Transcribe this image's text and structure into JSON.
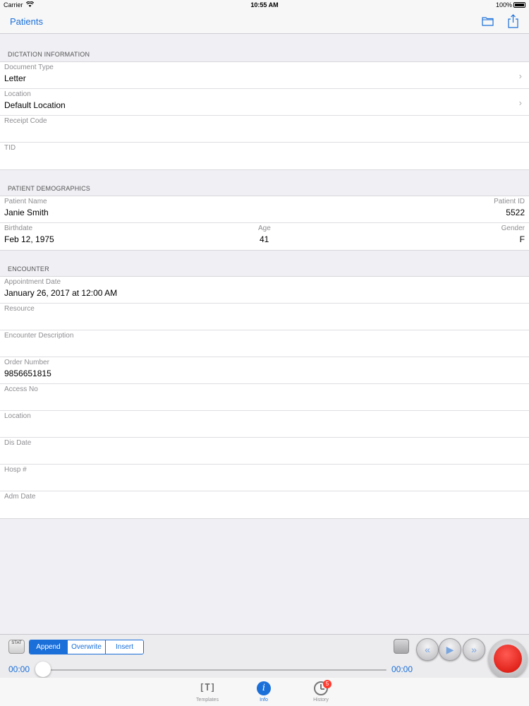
{
  "status_bar": {
    "carrier": "Carrier",
    "time": "10:55 AM",
    "battery": "100%"
  },
  "nav": {
    "back_label": "Patients",
    "folder_icon": "folder-icon",
    "share_icon": "share-icon"
  },
  "sections": {
    "dictation": {
      "header": "DICTATION INFORMATION",
      "rows": [
        {
          "label": "Document Type",
          "value": "Letter"
        },
        {
          "label": "Location",
          "value": "Default Location"
        },
        {
          "label": "Receipt Code",
          "value": ""
        },
        {
          "label": "TID",
          "value": ""
        }
      ]
    },
    "demographics": {
      "header": "PATIENT DEMOGRAPHICS",
      "patient_name_label": "Patient Name",
      "patient_name": "Janie Smith",
      "patient_id_label": "Patient ID",
      "patient_id": "5522",
      "birthdate_label": "Birthdate",
      "birthdate": "Feb 12, 1975",
      "age_label": "Age",
      "age": "41",
      "gender_label": "Gender",
      "gender": "F"
    },
    "encounter": {
      "header": "ENCOUNTER",
      "rows": [
        {
          "label": "Appointment Date",
          "value": "January 26, 2017 at 12:00 AM"
        },
        {
          "label": "Resource",
          "value": ""
        },
        {
          "label": "Encounter Description",
          "value": ""
        },
        {
          "label": "Order Number",
          "value": "9856651815"
        },
        {
          "label": "Access No",
          "value": ""
        },
        {
          "label": "Location",
          "value": ""
        },
        {
          "label": "Dis Date",
          "value": ""
        },
        {
          "label": "Hosp #",
          "value": ""
        },
        {
          "label": "Adm Date",
          "value": ""
        }
      ]
    }
  },
  "recorder": {
    "stat_label": "STAT",
    "modes": [
      "Append",
      "Overwrite",
      "Insert"
    ],
    "active_mode": "Append",
    "elapsed": "00:00",
    "total": "00:00",
    "progress": 0
  },
  "tabs": [
    {
      "label": "Templates",
      "icon": "templates-icon"
    },
    {
      "label": "Info",
      "icon": "info-icon",
      "active": true
    },
    {
      "label": "History",
      "icon": "history-clock-icon",
      "badge": "5"
    }
  ]
}
